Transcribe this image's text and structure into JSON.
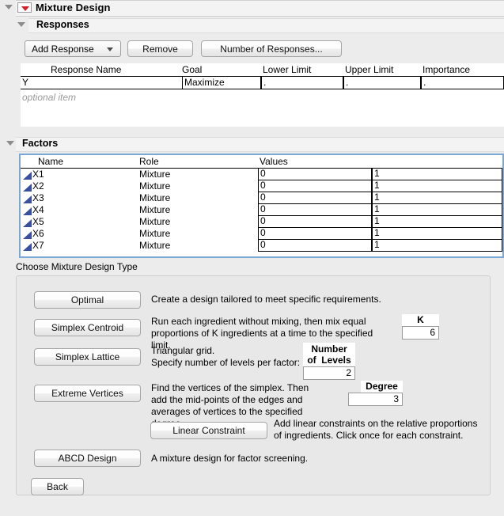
{
  "window": {
    "title": "Mixture Design",
    "red_menu_icon": "red-triangle-menu-icon"
  },
  "responses": {
    "section_label": "Responses",
    "buttons": {
      "add_response": "Add Response",
      "remove": "Remove",
      "number_of_responses": "Number of Responses..."
    },
    "table": {
      "columns": [
        "Response Name",
        "Goal",
        "Lower Limit",
        "Upper Limit",
        "Importance"
      ],
      "rows": [
        {
          "name": "Y",
          "goal": "Maximize",
          "lower_limit": ".",
          "upper_limit": ".",
          "importance": "."
        }
      ],
      "optional_hint": "optional item"
    }
  },
  "factors": {
    "section_label": "Factors",
    "table": {
      "columns": [
        "Name",
        "Role",
        "Values"
      ],
      "rows": [
        {
          "name": "X1",
          "role": "Mixture",
          "low": "0",
          "high": "1"
        },
        {
          "name": "X2",
          "role": "Mixture",
          "low": "0",
          "high": "1"
        },
        {
          "name": "X3",
          "role": "Mixture",
          "low": "0",
          "high": "1"
        },
        {
          "name": "X4",
          "role": "Mixture",
          "low": "0",
          "high": "1"
        },
        {
          "name": "X5",
          "role": "Mixture",
          "low": "0",
          "high": "1"
        },
        {
          "name": "X6",
          "role": "Mixture",
          "low": "0",
          "high": "1"
        },
        {
          "name": "X7",
          "role": "Mixture",
          "low": "0",
          "high": "1"
        }
      ]
    }
  },
  "design": {
    "section_label": "Choose Mixture Design Type",
    "optimal": {
      "button": "Optimal",
      "description": "Create a design tailored to meet specific requirements."
    },
    "simplex_centroid": {
      "button": "Simplex Centroid",
      "description_line1": "Run each ingredient without mixing, then mix equal",
      "description_line2": "proportions of K ingredients at a time to the specified limit.",
      "k_label": "K",
      "k_value": "6"
    },
    "simplex_lattice": {
      "button": "Simplex Lattice",
      "description_line1": "Triangular grid.",
      "description_line2": "Specify number of levels per factor:",
      "levels_label": "Number\nof  Levels",
      "levels_value": "2"
    },
    "extreme_vertices": {
      "button": "Extreme Vertices",
      "description_line1": "Find the vertices of the simplex. Then",
      "description_line2": "add the mid-points of the edges and",
      "description_line3": "averages of vertices to the specified degree.",
      "degree_label": "Degree",
      "degree_value": "3"
    },
    "linear_constraint": {
      "button": "Linear Constraint",
      "description_line1": "Add linear constraints on the relative proportions",
      "description_line2": "of ingredients. Click once for each constraint."
    },
    "abcd_design": {
      "button": "ABCD Design",
      "description": "A mixture design for factor screening."
    },
    "back": {
      "button": "Back"
    }
  },
  "colors": {
    "window_background": "#ececec",
    "panel_background": "#e8e8e8",
    "table_background": "#ffffff",
    "selection_border": "#7ba7d7",
    "factor_icon": "#3b4fa0",
    "red_triangle": "#d2232a",
    "hint_text": "#9a9a9a"
  }
}
